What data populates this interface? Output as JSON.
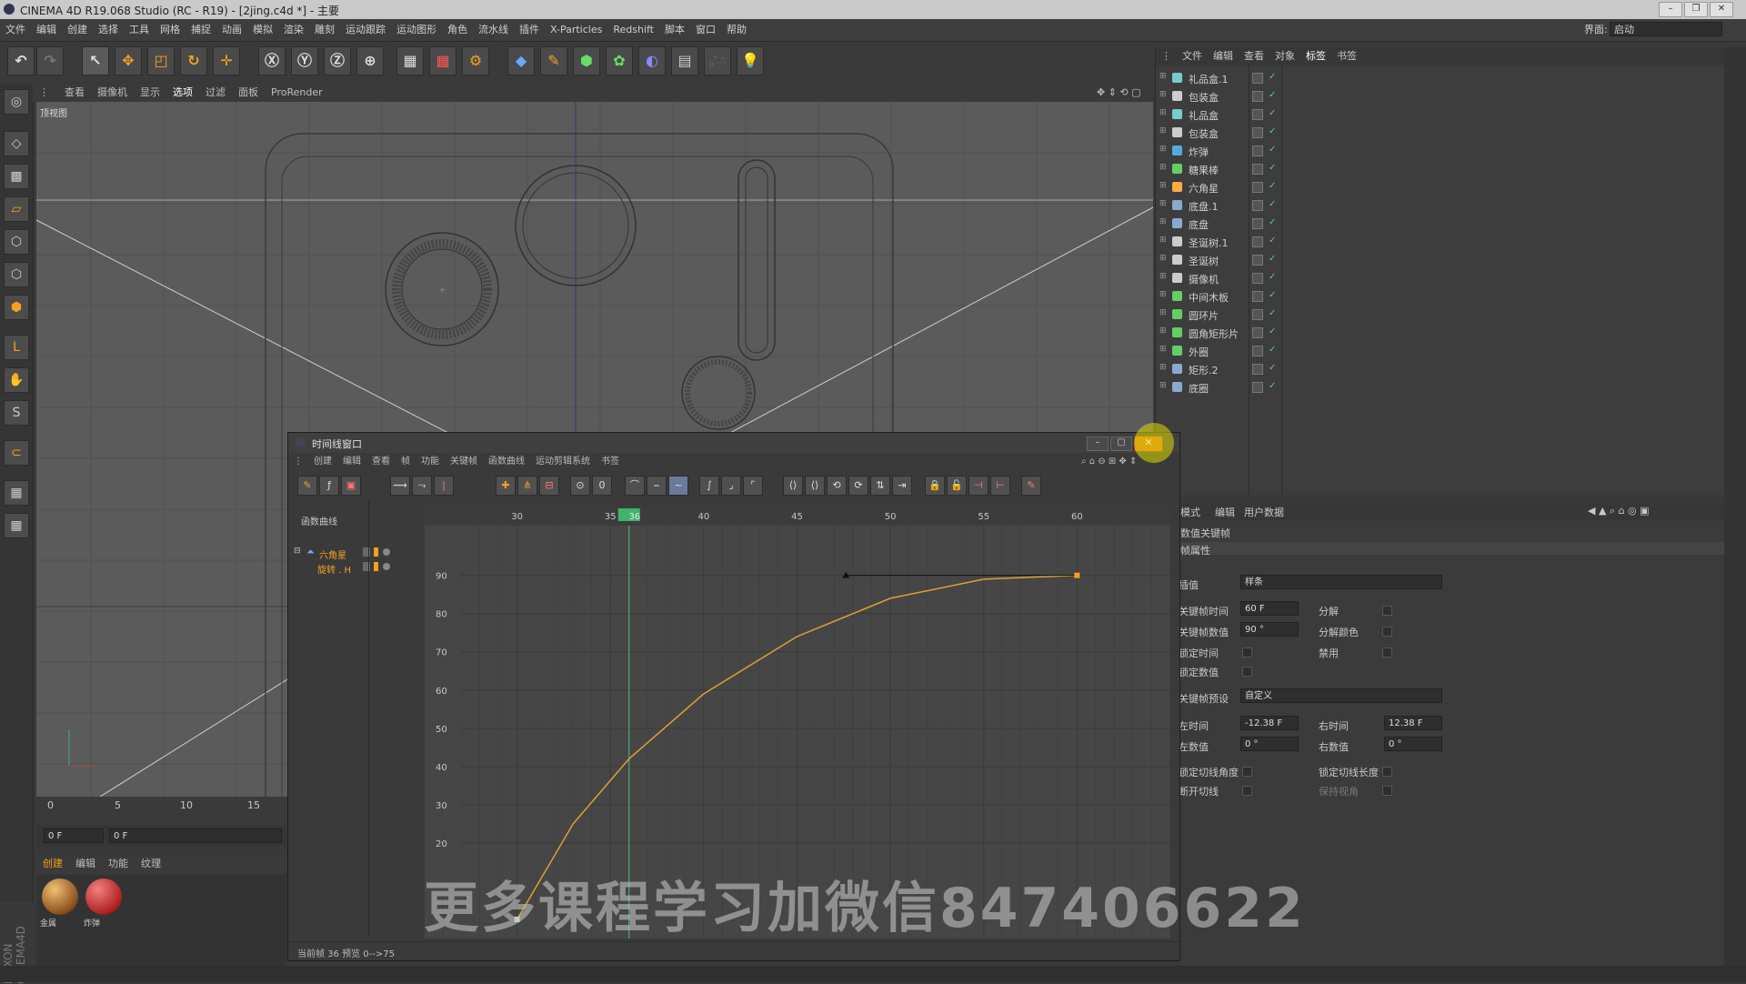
{
  "window": {
    "title": "CINEMA 4D R19.068 Studio (RC - R19) - [2jing.c4d *] - 主要"
  },
  "menubar": [
    "文件",
    "编辑",
    "创建",
    "选择",
    "工具",
    "网格",
    "捕捉",
    "动画",
    "模拟",
    "渲染",
    "雕刻",
    "运动跟踪",
    "运动图形",
    "角色",
    "流水线",
    "插件",
    "X-Particles",
    "Redshift",
    "脚本",
    "窗口",
    "帮助"
  ],
  "layout": {
    "label": "界面:",
    "value": "启动"
  },
  "viewport": {
    "menu": [
      "查看",
      "摄像机",
      "显示",
      "选项",
      "过滤",
      "面板",
      "ProRender"
    ],
    "view_label": "顶视图"
  },
  "timeline_ruler": {
    "ticks": [
      "0",
      "5",
      "10",
      "15"
    ],
    "current_frame": "0 F",
    "start_frame": "0 F"
  },
  "material_panel": {
    "menu": [
      "创建",
      "编辑",
      "功能",
      "纹理"
    ],
    "materials": [
      "金属",
      "炸弹"
    ]
  },
  "object_manager": {
    "menu": [
      "文件",
      "编辑",
      "查看",
      "对象",
      "标签",
      "书签"
    ],
    "objects": [
      {
        "name": "礼品盒.1",
        "color": "#7cc"
      },
      {
        "name": "包装盒",
        "color": "#cccccc"
      },
      {
        "name": "礼品盒",
        "color": "#7cc"
      },
      {
        "name": "包装盒",
        "color": "#cccccc"
      },
      {
        "name": "炸弹",
        "color": "#5ad"
      },
      {
        "name": "糖果棒",
        "color": "#6c6"
      },
      {
        "name": "六角星",
        "color": "#fa4"
      },
      {
        "name": "底盘.1",
        "color": "#8ac"
      },
      {
        "name": "底盘",
        "color": "#8ac"
      },
      {
        "name": "圣诞树.1",
        "color": "#ccc"
      },
      {
        "name": "圣诞树",
        "color": "#ccc"
      },
      {
        "name": "摄像机",
        "color": "#ccc"
      },
      {
        "name": "中间木板",
        "color": "#6c6"
      },
      {
        "name": "圆环片",
        "color": "#6c6"
      },
      {
        "name": "圆角矩形片",
        "color": "#6c6"
      },
      {
        "name": "外圈",
        "color": "#6c6"
      },
      {
        "name": "矩形.2",
        "color": "#8ac"
      },
      {
        "name": "底圈",
        "color": "#8ac"
      }
    ]
  },
  "attribute_manager": {
    "menu": [
      "模式",
      "编辑",
      "用户数据"
    ],
    "section": "数值关键帧",
    "group": "帧属性",
    "interpolation": {
      "label": "插值",
      "value": "样条"
    },
    "key_time": {
      "label": "关键帧时间",
      "value": "60 F"
    },
    "key_value": {
      "label": "关键帧数值",
      "value": "90 °"
    },
    "split": "分解",
    "split_color": "分解颜色",
    "lock_time": "锁定时间",
    "mute": "禁用",
    "lock_value": "锁定数值",
    "preset": {
      "label": "关键帧预设",
      "value": "自定义"
    },
    "left_time": {
      "label": "左时间",
      "value": "-12.38 F"
    },
    "right_time": {
      "label": "右时间",
      "value": "12.38 F"
    },
    "left_value": {
      "label": "左数值",
      "value": "0 °"
    },
    "right_value": {
      "label": "右数值",
      "value": "0 °"
    },
    "lock_tangent_angle": "锁定切线角度",
    "lock_tangent_length": "锁定切线长度",
    "break_tangent": "断开切线",
    "keep_visual": "保持视角"
  },
  "timeline_window": {
    "title": "时间线窗口",
    "menu": [
      "创建",
      "编辑",
      "查看",
      "帧",
      "功能",
      "关键帧",
      "函数曲线",
      "运动剪辑系统",
      "书签"
    ],
    "left_header": "函数曲线",
    "tracks": [
      {
        "name": "六角星"
      },
      {
        "name": "旋转 . H"
      }
    ],
    "status": "当前帧  36  预览  0-->75"
  },
  "chart_data": {
    "type": "line",
    "title": "",
    "xlabel": "",
    "ylabel": "",
    "xlim": [
      27,
      65
    ],
    "ylim": [
      -5,
      103
    ],
    "x_ticks": [
      30,
      35,
      36,
      40,
      45,
      50,
      55,
      60
    ],
    "y_ticks": [
      20,
      30,
      40,
      50,
      60,
      70,
      80,
      90
    ],
    "current_frame": 36,
    "series": [
      {
        "x": [
          30,
          33,
          36,
          40,
          45,
          50,
          55,
          60
        ],
        "values": [
          0,
          25,
          42,
          59,
          74,
          84,
          89,
          90
        ]
      }
    ],
    "keys": [
      {
        "x": 30,
        "y": 0
      },
      {
        "x": 60,
        "y": 90
      }
    ],
    "tangent_handle": {
      "x_left": 47.62,
      "x_right": 60,
      "y": 90
    },
    "curve_color": "#e0a030"
  },
  "watermark": "更多课程学习加微信847406622"
}
